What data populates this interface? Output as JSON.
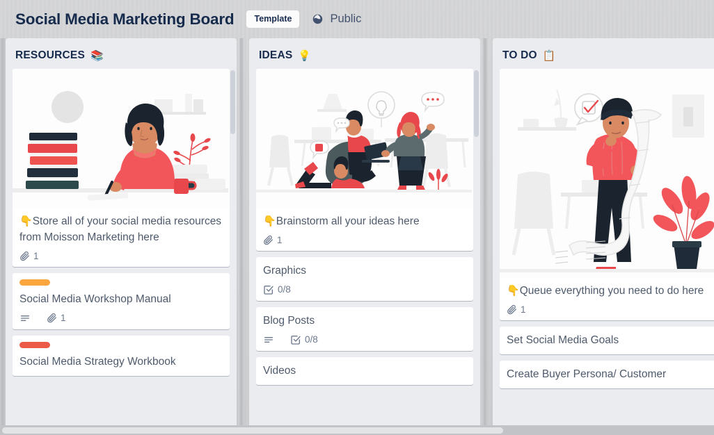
{
  "header": {
    "title": "Social Media Marketing Board",
    "template_badge": "Template",
    "visibility_label": "Public",
    "visibility_icon": "globe-icon"
  },
  "colors": {
    "board_background": "#cfd0d2",
    "list_background": "#ebecf0",
    "card_background": "#ffffff",
    "title_text": "#172b4d",
    "card_text": "#4e5a6b",
    "badge_text": "#6b778c",
    "label_orange": "#faa53d",
    "label_red": "#eb5a46",
    "illustration_red": "#f2565a",
    "illustration_dark": "#1f2b38",
    "illustration_gray": "#e8e8e8"
  },
  "lists": [
    {
      "title": "RESOURCES",
      "emoji": "📚",
      "emoji_name": "books-emoji",
      "cards": [
        {
          "has_cover": true,
          "cover_name": "woman-writing-at-desk-illustration",
          "title_emoji": "👇",
          "title": "Store all of your social media resources from Moisson Marketing here",
          "badges": [
            {
              "icon": "paperclip-icon",
              "value": "1"
            }
          ],
          "labels": []
        },
        {
          "has_cover": false,
          "title_emoji": "",
          "title": "Social Media Workshop Manual",
          "badges": [
            {
              "icon": "description-icon",
              "value": ""
            },
            {
              "icon": "paperclip-icon",
              "value": "1"
            }
          ],
          "labels": [
            "#faa53d"
          ]
        },
        {
          "has_cover": false,
          "title_emoji": "",
          "title": "Social Media Strategy Workbook",
          "badges": [],
          "labels": [
            "#eb5a46"
          ]
        }
      ]
    },
    {
      "title": "IDEAS",
      "emoji": "💡",
      "emoji_name": "lightbulb-emoji",
      "cards": [
        {
          "has_cover": true,
          "cover_name": "team-brainstorming-illustration",
          "title_emoji": "👇",
          "title": "Brainstorm all your ideas here",
          "badges": [
            {
              "icon": "paperclip-icon",
              "value": "1"
            }
          ],
          "labels": []
        },
        {
          "has_cover": false,
          "title_emoji": "",
          "title": "Graphics",
          "badges": [
            {
              "icon": "checklist-icon",
              "value": "0/8"
            }
          ],
          "labels": []
        },
        {
          "has_cover": false,
          "title_emoji": "",
          "title": "Blog Posts",
          "badges": [
            {
              "icon": "description-icon",
              "value": ""
            },
            {
              "icon": "checklist-icon",
              "value": "0/8"
            }
          ],
          "labels": []
        },
        {
          "has_cover": false,
          "title_emoji": "",
          "title": "Videos",
          "badges": [],
          "labels": []
        }
      ]
    },
    {
      "title": "TO DO",
      "emoji": "📋",
      "emoji_name": "clipboard-emoji",
      "cards": [
        {
          "has_cover": true,
          "cover_name": "man-with-long-checklist-illustration",
          "title_emoji": "👇",
          "title": "Queue everything you need to do here",
          "badges": [
            {
              "icon": "paperclip-icon",
              "value": "1"
            }
          ],
          "labels": []
        },
        {
          "has_cover": false,
          "title_emoji": "",
          "title": "Set Social Media Goals",
          "badges": [],
          "labels": []
        },
        {
          "has_cover": false,
          "title_emoji": "",
          "title": "Create Buyer Persona/ Customer",
          "badges": [],
          "labels": []
        }
      ]
    }
  ]
}
